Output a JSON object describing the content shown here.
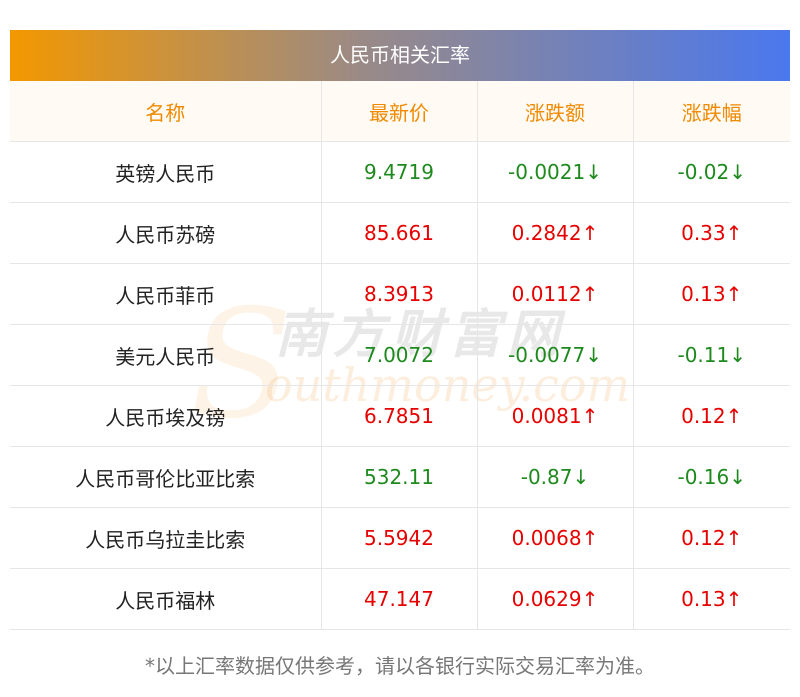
{
  "title": "人民币相关汇率",
  "columns": [
    "名称",
    "最新价",
    "涨跌额",
    "涨跌幅"
  ],
  "rows": [
    {
      "name": "英镑人民币",
      "price": "9.4719",
      "change": "-0.0021↓",
      "pct": "-0.02↓",
      "dir": "down"
    },
    {
      "name": "人民币苏磅",
      "price": "85.661",
      "change": "0.2842↑",
      "pct": "0.33↑",
      "dir": "up"
    },
    {
      "name": "人民币菲币",
      "price": "8.3913",
      "change": "0.0112↑",
      "pct": "0.13↑",
      "dir": "up"
    },
    {
      "name": "美元人民币",
      "price": "7.0072",
      "change": "-0.0077↓",
      "pct": "-0.11↓",
      "dir": "down"
    },
    {
      "name": "人民币埃及镑",
      "price": "6.7851",
      "change": "0.0081↑",
      "pct": "0.12↑",
      "dir": "up"
    },
    {
      "name": "人民币哥伦比亚比索",
      "price": "532.11",
      "change": "-0.87↓",
      "pct": "-0.16↓",
      "dir": "down"
    },
    {
      "name": "人民币乌拉圭比索",
      "price": "5.5942",
      "change": "0.0068↑",
      "pct": "0.12↑",
      "dir": "up"
    },
    {
      "name": "人民币福林",
      "price": "47.147",
      "change": "0.0629↑",
      "pct": "0.13↑",
      "dir": "up"
    }
  ],
  "footnote": "*以上汇率数据仅供参考，请以各银行实际交易汇率为准。",
  "watermark": {
    "cn": "南方财富网",
    "en": "outhmoney.com",
    "letter": "S"
  },
  "colors": {
    "up": "#e60000",
    "down": "#1e8a1e",
    "header_text": "#f08a00"
  }
}
